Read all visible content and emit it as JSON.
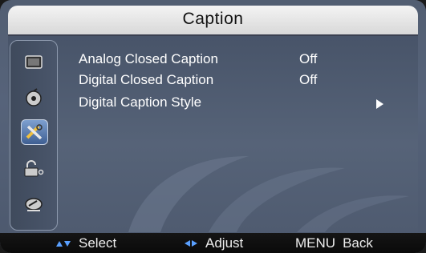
{
  "window": {
    "title": "Caption"
  },
  "sidebar": {
    "items": [
      {
        "icon": "picture-icon",
        "selected": false
      },
      {
        "icon": "sound-icon",
        "selected": false
      },
      {
        "icon": "setup-tools-icon",
        "selected": true
      },
      {
        "icon": "lock-icon",
        "selected": false
      },
      {
        "icon": "channel-antenna-icon",
        "selected": false
      }
    ]
  },
  "menu": {
    "items": [
      {
        "label": "Analog Closed Caption",
        "value": "Off"
      },
      {
        "label": "Digital Closed Caption",
        "value": "Off"
      },
      {
        "label": "Digital Caption Style",
        "submenu": true
      }
    ]
  },
  "footer": {
    "select_label": "Select",
    "adjust_label": "Adjust",
    "menu_label": "MENU",
    "back_label": "Back"
  },
  "colors": {
    "accent": "#5aa0ff",
    "background": "#56637a",
    "title_bar": "#e6e6e6"
  }
}
